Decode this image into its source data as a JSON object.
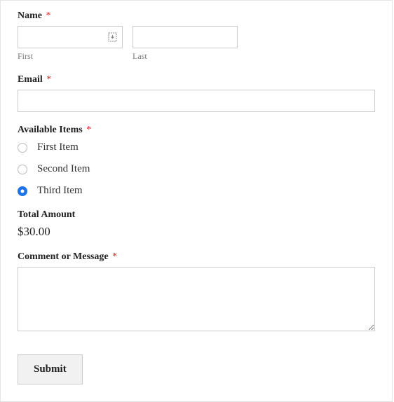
{
  "fields": {
    "name": {
      "label": "Name",
      "required_mark": "*",
      "first_sublabel": "First",
      "last_sublabel": "Last"
    },
    "email": {
      "label": "Email",
      "required_mark": "*"
    },
    "available_items": {
      "label": "Available Items",
      "required_mark": "*",
      "options": [
        {
          "label": "First Item",
          "selected": false
        },
        {
          "label": "Second Item",
          "selected": false
        },
        {
          "label": "Third Item",
          "selected": true
        }
      ]
    },
    "total_amount": {
      "label": "Total Amount",
      "value": "$30.00"
    },
    "comment": {
      "label": "Comment or Message",
      "required_mark": "*"
    }
  },
  "submit_label": "Submit"
}
